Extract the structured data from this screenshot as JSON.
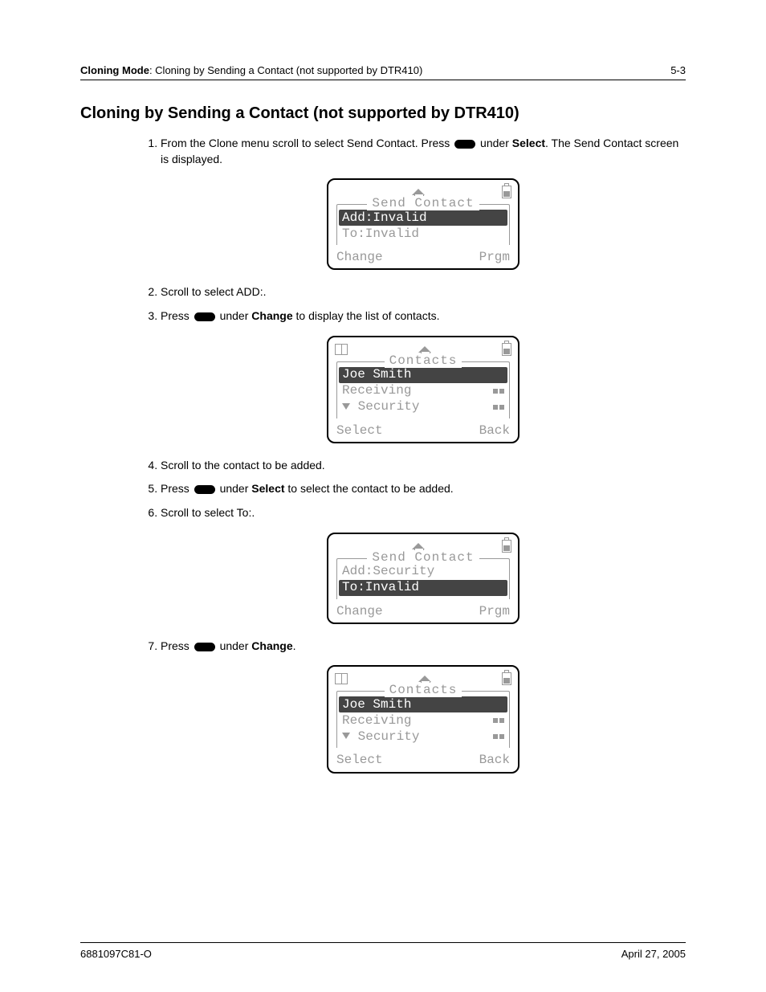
{
  "header": {
    "section": "Cloning Mode",
    "subsection": "Cloning by Sending a Contact (not supported by DTR410)",
    "page_ref": "5-3"
  },
  "title": "Cloning by Sending a Contact (not supported by DTR410)",
  "steps": {
    "s1a": "From the Clone menu scroll to select Send Contact. Press ",
    "s1b": " under ",
    "s1c": "Select",
    "s1d": ". The Send Contact screen is displayed.",
    "s2": "Scroll to select ADD:.",
    "s3a": "Press ",
    "s3b": " under ",
    "s3c": "Change",
    "s3d": " to display the list of contacts.",
    "s4": "Scroll to the contact to be added.",
    "s5a": "Press ",
    "s5b": " under ",
    "s5c": "Select",
    "s5d": " to select the contact to be added.",
    "s6": "Scroll to select To:.",
    "s7a": "Press ",
    "s7b": " under ",
    "s7c": "Change",
    "s7d": "."
  },
  "screens": {
    "sc1": {
      "title": "Send Contact",
      "row1": "Add:Invalid",
      "row2": "To:Invalid",
      "left": "Change",
      "right": "Prgm"
    },
    "sc2": {
      "title": "Contacts",
      "row1": "Joe Smith",
      "row2": "Receiving",
      "row3": "Security",
      "left": "Select",
      "right": "Back"
    },
    "sc3": {
      "title": "Send Contact",
      "row1": "Add:Security",
      "row2": "To:Invalid",
      "left": "Change",
      "right": "Prgm"
    },
    "sc4": {
      "title": "Contacts",
      "row1": "Joe Smith",
      "row2": "Receiving",
      "row3": "Security",
      "left": "Select",
      "right": "Back"
    }
  },
  "footer": {
    "doc_id": "6881097C81-O",
    "date": "April 27, 2005"
  }
}
